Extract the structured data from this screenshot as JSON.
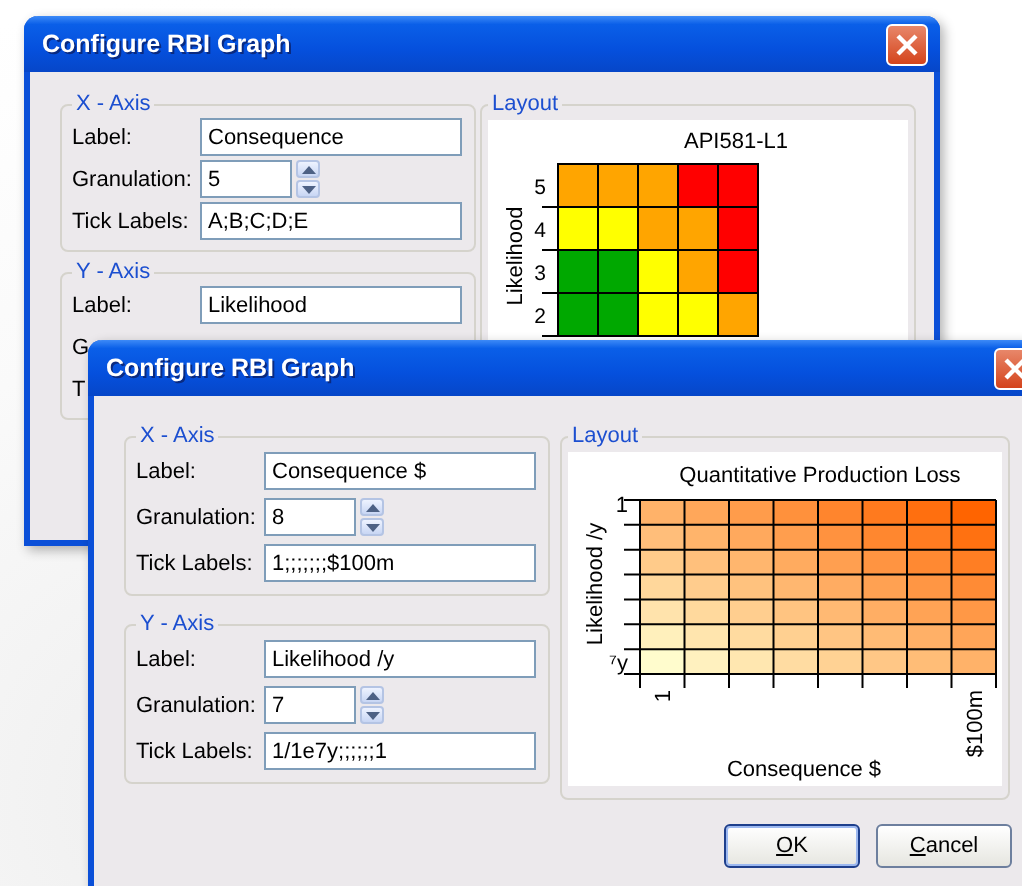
{
  "windows": [
    {
      "title": "Configure RBI Graph",
      "x_axis": {
        "legend": "X - Axis",
        "fields": [
          {
            "kind": "text",
            "label": "Label:",
            "value": "Consequence"
          },
          {
            "kind": "spin",
            "label": "Granulation:",
            "value": "5"
          },
          {
            "kind": "text",
            "label": "Tick Labels:",
            "value": "A;B;C;D;E"
          }
        ]
      },
      "y_axis": {
        "legend": "Y - Axis",
        "fields": [
          {
            "kind": "text",
            "label": "Label:",
            "value": "Likelihood"
          },
          {
            "kind": "covered",
            "label": "G"
          },
          {
            "kind": "covered",
            "label": "T"
          }
        ]
      },
      "layout": {
        "legend": "Layout",
        "kind": "matrix",
        "chart_title": "API581-L1",
        "y_label": "Likelihood",
        "y_ticks": [
          "5",
          "4",
          "3",
          "2"
        ],
        "rows": [
          {
            "cells": [
              {
                "color": "#ffa500"
              },
              {
                "color": "#ffa500"
              },
              {
                "color": "#ffa500"
              },
              {
                "color": "#ff0000"
              },
              {
                "color": "#ff0000"
              }
            ]
          },
          {
            "cells": [
              {
                "color": "#ffff00"
              },
              {
                "color": "#ffff00"
              },
              {
                "color": "#ffa500"
              },
              {
                "color": "#ffa500"
              },
              {
                "color": "#ff0000"
              }
            ]
          },
          {
            "cells": [
              {
                "color": "#00a800"
              },
              {
                "color": "#00a800"
              },
              {
                "color": "#ffff00"
              },
              {
                "color": "#ffa500"
              },
              {
                "color": "#ff0000"
              }
            ]
          },
          {
            "cells": [
              {
                "color": "#00a800"
              },
              {
                "color": "#00a800"
              },
              {
                "color": "#ffff00"
              },
              {
                "color": "#ffff00"
              },
              {
                "color": "#ffa500"
              }
            ]
          }
        ]
      }
    },
    {
      "title": "Configure RBI Graph",
      "x_axis": {
        "legend": "X - Axis",
        "fields": [
          {
            "kind": "text",
            "label": "Label:",
            "value": "Consequence $"
          },
          {
            "kind": "spin",
            "label": "Granulation:",
            "value": "8"
          },
          {
            "kind": "text",
            "label": "Tick Labels:",
            "value": "1;;;;;;;$100m"
          }
        ]
      },
      "y_axis": {
        "legend": "Y - Axis",
        "fields": [
          {
            "kind": "text",
            "label": "Label:",
            "value": "Likelihood /y"
          },
          {
            "kind": "spin",
            "label": "Granulation:",
            "value": "7"
          },
          {
            "kind": "text",
            "label": "Tick Labels:",
            "value": "1/1e7y;;;;;;1"
          }
        ]
      },
      "layout": {
        "legend": "Layout",
        "kind": "gradient",
        "chart_title": "Quantitative Production Loss",
        "y_label": "Likelihood /y",
        "y_ticks": [
          "1",
          "⁷y"
        ],
        "x_ticks": [
          "1",
          "$100m"
        ],
        "x_label": "Consequence $"
      },
      "buttons": [
        {
          "label": "OK",
          "default": true
        },
        {
          "label": "Cancel",
          "default": false
        }
      ]
    }
  ]
}
